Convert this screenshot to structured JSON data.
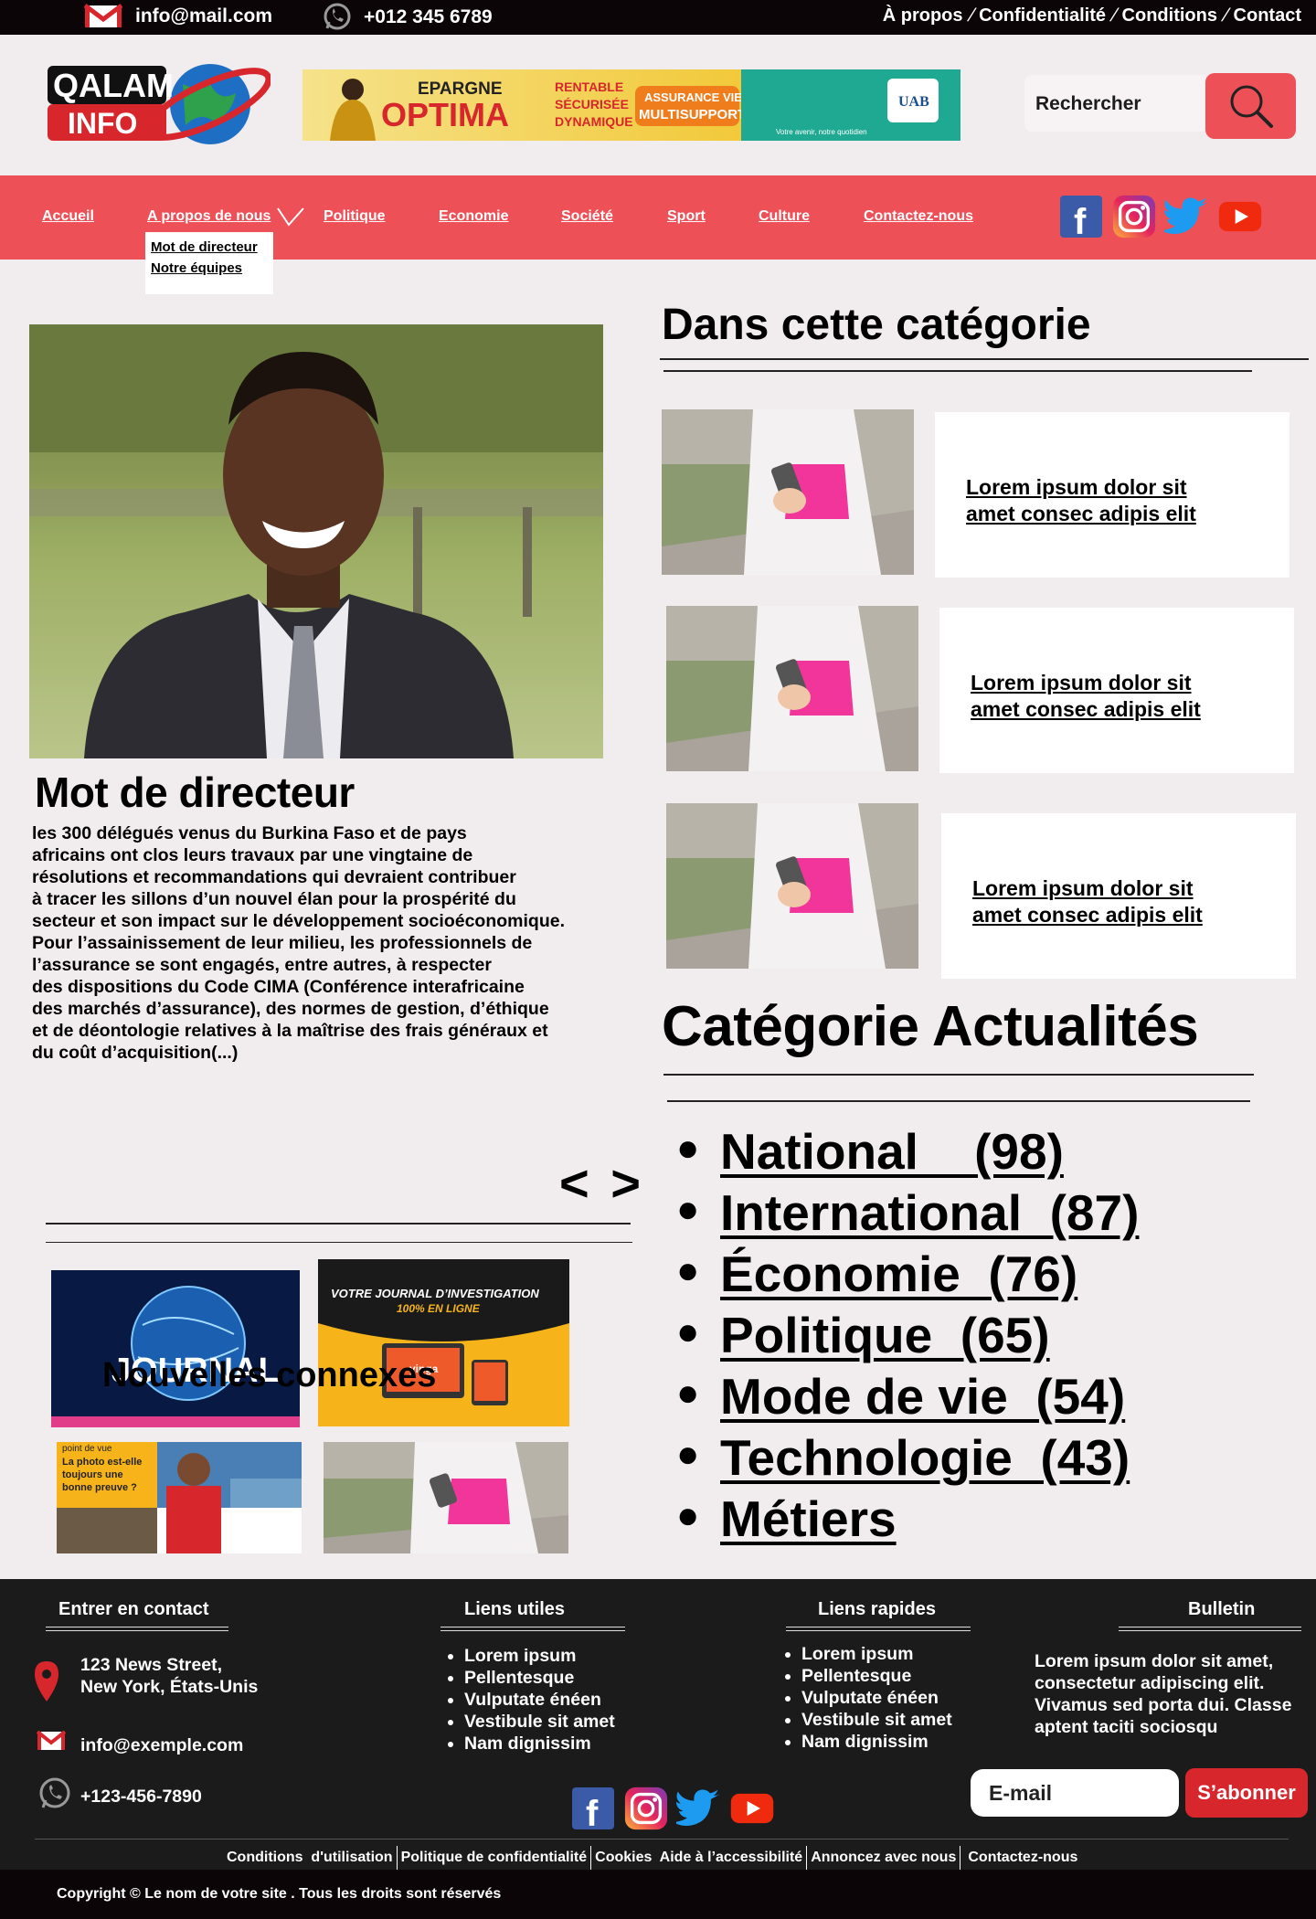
{
  "topbar": {
    "email": "info@mail.com",
    "phone": "+012 345 6789",
    "links": [
      "À propos",
      "Confidentialité",
      "Conditions",
      "Contact"
    ]
  },
  "logo": {
    "line1": "QALAM",
    "line2": "INFO"
  },
  "banner": {
    "line1": "EPARGNE",
    "line2": "OPTIMA",
    "checks": [
      "RENTABLE",
      "SÉCURISÉE",
      "DYNAMIQUE"
    ],
    "badge_line1": "ASSURANCE VIE",
    "badge_line2": "MULTISUPPORTS",
    "brand": "UAB",
    "tagline": "Votre avenir, notre quotidien"
  },
  "search": {
    "placeholder": "Rechercher"
  },
  "nav": {
    "items": [
      "Accueil",
      "A propos de nous",
      "Politique",
      "Economie",
      "Société",
      "Sport",
      "Culture",
      "Contactez-nous"
    ],
    "dropdown": [
      "Mot de directeur",
      "Notre équipes"
    ]
  },
  "article": {
    "title": "Mot de directeur",
    "body": "les 300 délégués venus du Burkina Faso et de pays\n africains ont clos leurs travaux par une vingtaine de\n résolutions et recommandations qui devraient contribuer\n à tracer les sillons d’un nouvel élan pour la prospérité du\nsecteur et son impact sur le développement socioéconomique.\nPour l’assainissement de leur milieu, les professionnels de\nl’assurance se sont engagés, entre autres, à respecter\ndes dispositions du Code CIMA (Conférence interafricaine\ndes marchés d’assurance), des normes de gestion, d’éthique\net de déontologie relatives à la maîtrise des frais généraux et\ndu coût d’acquisition(...)"
  },
  "category": {
    "title": "Dans cette catégorie",
    "items": [
      {
        "text": "Lorem ipsum dolor sit\n amet consec adipis elit"
      },
      {
        "text": "Lorem ipsum dolor sit\n amet consec adipis elit"
      },
      {
        "text": "Lorem ipsum dolor sit\n amet consec adipis elit"
      }
    ]
  },
  "news_categories": {
    "title": "Catégorie Actualités",
    "items": [
      {
        "label": "National    (98)"
      },
      {
        "label": "International  (87)"
      },
      {
        "label": "Économie  (76)"
      },
      {
        "label": "Politique  (65)"
      },
      {
        "label": "Mode de vie  (54)"
      },
      {
        "label": "Technologie  (43)"
      },
      {
        "label": "Métiers"
      }
    ]
  },
  "related": {
    "title": "Nouvelles connexes",
    "arrows": "< >",
    "img1_text": "JOURNAL",
    "img2_line1": "VOTRE JOURNAL  D’INVESTIGATION",
    "img2_line2": "100% EN LIGNE",
    "img2_brand": "yinga",
    "img3_top": "point de vue",
    "img3_line1": "La photo est-elle",
    "img3_line2": "toujours une",
    "img3_line3": "bonne preuve ?"
  },
  "footer": {
    "contact": {
      "heading": "Entrer en contact",
      "address": "123 News Street,\nNew York, États-Unis",
      "email": "info@exemple.com",
      "phone": "+123-456-7890"
    },
    "useful": {
      "heading": "Liens utiles",
      "items": [
        "Lorem ipsum",
        "Pellentesque",
        "Vulputate énéen",
        "Vestibule sit amet",
        "Nam dignissim"
      ]
    },
    "quick": {
      "heading": "Liens rapides",
      "items": [
        "Lorem ipsum",
        "Pellentesque",
        "Vulputate énéen",
        "Vestibule sit amet",
        "Nam dignissim"
      ]
    },
    "newsletter": {
      "heading": "Bulletin",
      "text": "Lorem ipsum dolor sit amet,\nconsectetur adipiscing elit.\nVivamus sed porta dui. Classe\n aptent taciti sociosqu",
      "email_placeholder": "E-mail",
      "button": "S’abonner"
    },
    "legal": [
      "Conditions  d'utilisation",
      "Politique de confidentialité",
      "Cookies  Aide à l’accessibilité",
      "Annoncez avec nous",
      "Contactez-nous"
    ],
    "copyright": "Copyright © Le nom de votre site . Tous les droits sont réservés"
  },
  "colors": {
    "accent": "#ee5058",
    "dark": "#1b1b1b",
    "background": "#f1ecee"
  }
}
